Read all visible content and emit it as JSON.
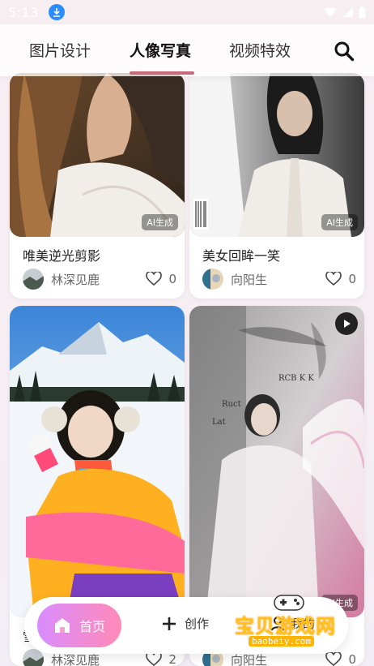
{
  "status_bar": {
    "time": "5:13"
  },
  "tabs": [
    {
      "label": "图片设计",
      "active": false
    },
    {
      "label": "人像写真",
      "active": true
    },
    {
      "label": "视频特效",
      "active": false
    }
  ],
  "cards": [
    {
      "title": "唯美逆光剪影",
      "author": "林深见鹿",
      "likes": "0",
      "badge": "AI生成"
    },
    {
      "title": "美女回眸一笑",
      "author": "向阳生",
      "likes": "0",
      "badge": "AI生成"
    },
    {
      "title": "雪",
      "author": "林深见鹿",
      "likes": "2",
      "badge": ""
    },
    {
      "title": "",
      "author": "向阳生",
      "likes": "0",
      "badge": "AI生成"
    }
  ],
  "bottom_nav": {
    "home": "首页",
    "create": "创作",
    "mine": "我的"
  },
  "watermark": {
    "text": "宝贝游戏网",
    "url": "baobeiy.com"
  },
  "colors": {
    "accent": "#c96a7a",
    "home_gradient_start": "#d98cff",
    "home_gradient_end": "#ff8ab6"
  }
}
